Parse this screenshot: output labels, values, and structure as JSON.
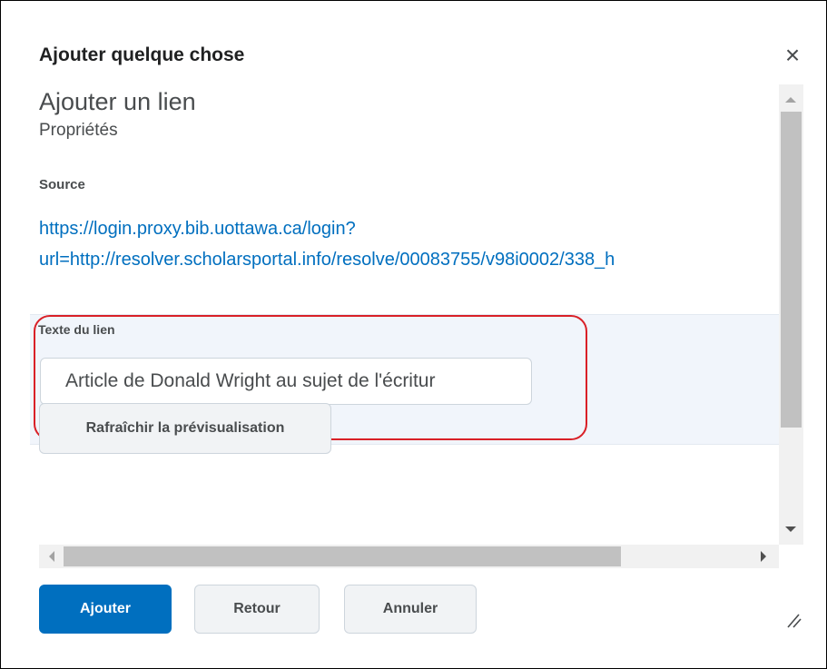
{
  "dialog": {
    "title": "Ajouter quelque chose",
    "close_icon": "×"
  },
  "content": {
    "heading": "Ajouter un lien",
    "subheading": "Propriétés",
    "source_label": "Source",
    "source_url_line1": "https://login.proxy.bib.uottawa.ca/login?",
    "source_url_line2": "url=http://resolver.scholarsportal.info/resolve/00083755/v98i0002/338_h",
    "link_text_label": "Texte du lien",
    "link_text_value": "Article de Donald Wright au sujet de l'écritur",
    "refresh_button": "Rafraîchir la prévisualisation"
  },
  "footer": {
    "add_button": "Ajouter",
    "back_button": "Retour",
    "cancel_button": "Annuler"
  },
  "colors": {
    "primary": "#006fbf",
    "highlight": "#d92027",
    "link": "#006fbf"
  }
}
